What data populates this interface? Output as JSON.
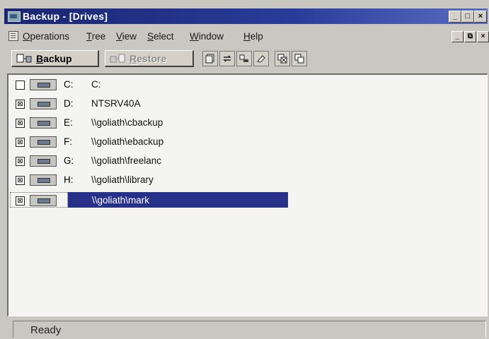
{
  "window": {
    "title": "Backup - [Drives]",
    "controls": [
      "minimize",
      "maximize",
      "close"
    ]
  },
  "menubar": {
    "items": [
      "Operations",
      "Tree",
      "View",
      "Select",
      "Window",
      "Help"
    ],
    "mdi_controls": [
      "minimize",
      "restore",
      "close"
    ]
  },
  "toolbar": {
    "backup_label": "Backup",
    "restore_label": "Restore",
    "restore_enabled": false,
    "tool_icons": [
      "catalog-icon",
      "transfer-icon",
      "tape-icon",
      "erase-icon",
      "select-all-icon",
      "deselect-icon"
    ]
  },
  "drives": [
    {
      "checked": false,
      "letter": "C:",
      "path": "C:",
      "type": "local-drive"
    },
    {
      "checked": true,
      "letter": "D:",
      "path": "NTSRV40A",
      "type": "local-drive"
    },
    {
      "checked": true,
      "letter": "E:",
      "path": "\\\\goliath\\cbackup",
      "type": "network-drive"
    },
    {
      "checked": true,
      "letter": "F:",
      "path": "\\\\goliath\\ebackup",
      "type": "network-drive"
    },
    {
      "checked": true,
      "letter": "G:",
      "path": "\\\\goliath\\freelanc",
      "type": "network-drive"
    },
    {
      "checked": true,
      "letter": "H:",
      "path": "\\\\goliath\\library",
      "type": "network-drive"
    },
    {
      "checked": true,
      "letter": "",
      "path": "\\\\goliath\\mark",
      "type": "network-drive",
      "selected": true
    }
  ],
  "status": {
    "text": "Ready"
  },
  "colors": {
    "titlebar": "#1a2670",
    "selection": "#27318a",
    "face": "#c9c7c2"
  }
}
